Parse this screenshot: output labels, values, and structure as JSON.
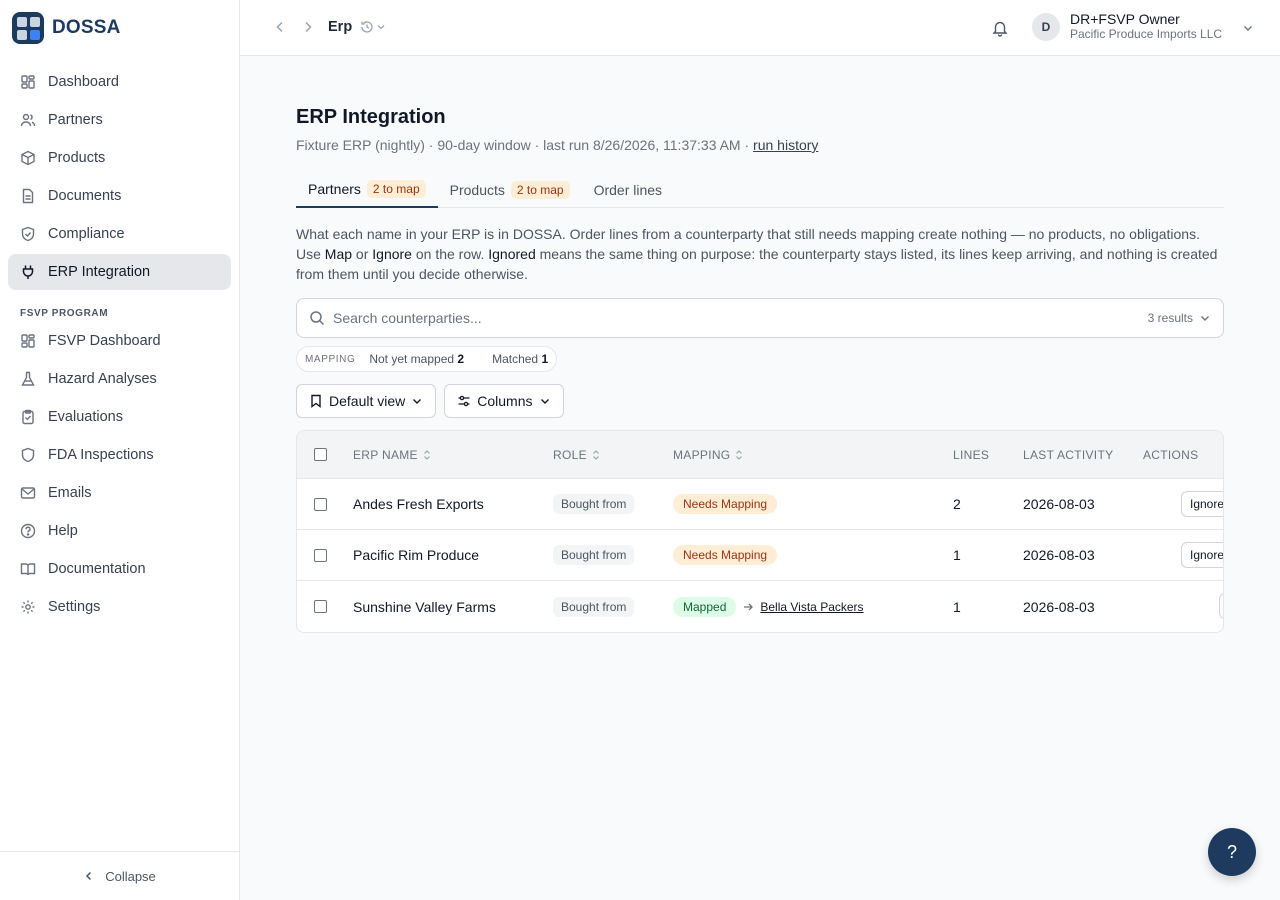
{
  "brand": {
    "name": "DOSSA"
  },
  "sidebar": {
    "items": [
      {
        "label": "Dashboard",
        "icon": "dashboard-icon"
      },
      {
        "label": "Partners",
        "icon": "users-icon"
      },
      {
        "label": "Products",
        "icon": "box-icon"
      },
      {
        "label": "Documents",
        "icon": "file-icon"
      },
      {
        "label": "Compliance",
        "icon": "shield-icon"
      },
      {
        "label": "ERP Integration",
        "icon": "plug-icon",
        "active": true
      }
    ],
    "section_label": "FSVP PROGRAM",
    "fsvp_items": [
      {
        "label": "FSVP Dashboard",
        "icon": "dashboard-icon"
      },
      {
        "label": "Hazard Analyses",
        "icon": "flask-icon"
      },
      {
        "label": "Evaluations",
        "icon": "clipboard-icon"
      },
      {
        "label": "FDA Inspections",
        "icon": "shield-icon"
      },
      {
        "label": "Emails",
        "icon": "mail-icon"
      },
      {
        "label": "Help",
        "icon": "help-circle-icon"
      },
      {
        "label": "Documentation",
        "icon": "book-icon"
      },
      {
        "label": "Settings",
        "icon": "gear-icon"
      }
    ],
    "collapse_label": "Collapse"
  },
  "topbar": {
    "breadcrumb": "Erp",
    "user_initial": "D",
    "user_name": "DR+FSVP Owner",
    "user_org": "Pacific Produce Imports LLC"
  },
  "page": {
    "title": "ERP Integration",
    "subtitle": "Fixture ERP (nightly) · 90-day window · last run 8/26/2026, 11:37:33 AM · ",
    "run_history_link": "run history",
    "tabs": [
      {
        "label": "Partners",
        "badge": "2 to map",
        "active": true
      },
      {
        "label": "Products",
        "badge": "2 to map"
      },
      {
        "label": "Order lines"
      }
    ],
    "desc": {
      "p1": "What each name in your ERP is in DOSSA. Order lines from a counterparty that still needs mapping create nothing — no products, no obligations. Use ",
      "map": "Map",
      "or": " or ",
      "ignore": "Ignore",
      "p2": " on the row. ",
      "ignored": "Ignored",
      "p3": " means the same thing on purpose: the counterparty stays listed, its lines keep arriving, and nothing is created from them until you decide otherwise."
    }
  },
  "search": {
    "placeholder": "Search counterparties...",
    "value": "",
    "results": "3 results"
  },
  "filters": {
    "label": "MAPPING",
    "items": [
      {
        "label": "Not yet mapped",
        "count": "2"
      },
      {
        "label": "Matched",
        "count": "1"
      }
    ]
  },
  "toolbar": {
    "view_label": "Default view",
    "columns_label": "Columns"
  },
  "table": {
    "headers": {
      "name": "ERP NAME",
      "role": "ROLE",
      "mapping": "MAPPING",
      "lines": "LINES",
      "last_activity": "LAST ACTIVITY",
      "actions": "ACTIONS"
    },
    "rows": [
      {
        "name": "Andes Fresh Exports",
        "role": "Bought from",
        "mapping": "Needs Mapping",
        "lines": "2",
        "last_activity": "2026-08-03",
        "action": "Ignore"
      },
      {
        "name": "Pacific Rim Produce",
        "role": "Bought from",
        "mapping": "Needs Mapping",
        "lines": "1",
        "last_activity": "2026-08-03",
        "action": "Ignore"
      },
      {
        "name": "Sunshine Valley Farms",
        "role": "Bought from",
        "mapping": "Mapped",
        "mapped_to": "Bella Vista Packers",
        "lines": "1",
        "last_activity": "2026-08-03"
      }
    ]
  },
  "help_fab": "?",
  "colors": {
    "brand": "#1e3a5f",
    "accent": "#3b82f6",
    "warning_bg": "#ffedd5",
    "warning_text": "#9a3412",
    "success_bg": "#dcfce7",
    "success_text": "#166534"
  }
}
